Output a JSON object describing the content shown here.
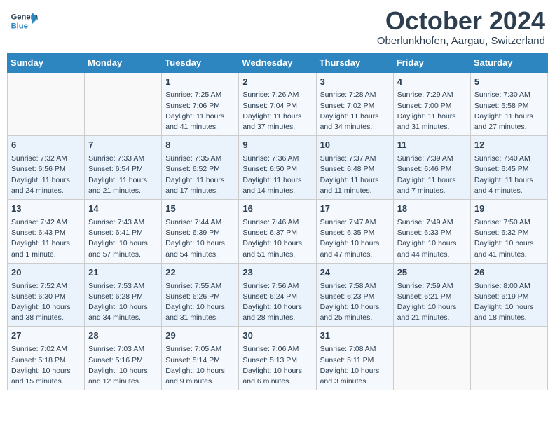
{
  "header": {
    "logo_general": "General",
    "logo_blue": "Blue",
    "month_title": "October 2024",
    "location": "Oberlunkhofen, Aargau, Switzerland"
  },
  "weekdays": [
    "Sunday",
    "Monday",
    "Tuesday",
    "Wednesday",
    "Thursday",
    "Friday",
    "Saturday"
  ],
  "weeks": [
    [
      {
        "day": "",
        "data": ""
      },
      {
        "day": "",
        "data": ""
      },
      {
        "day": "1",
        "data": "Sunrise: 7:25 AM\nSunset: 7:06 PM\nDaylight: 11 hours and 41 minutes."
      },
      {
        "day": "2",
        "data": "Sunrise: 7:26 AM\nSunset: 7:04 PM\nDaylight: 11 hours and 37 minutes."
      },
      {
        "day": "3",
        "data": "Sunrise: 7:28 AM\nSunset: 7:02 PM\nDaylight: 11 hours and 34 minutes."
      },
      {
        "day": "4",
        "data": "Sunrise: 7:29 AM\nSunset: 7:00 PM\nDaylight: 11 hours and 31 minutes."
      },
      {
        "day": "5",
        "data": "Sunrise: 7:30 AM\nSunset: 6:58 PM\nDaylight: 11 hours and 27 minutes."
      }
    ],
    [
      {
        "day": "6",
        "data": "Sunrise: 7:32 AM\nSunset: 6:56 PM\nDaylight: 11 hours and 24 minutes."
      },
      {
        "day": "7",
        "data": "Sunrise: 7:33 AM\nSunset: 6:54 PM\nDaylight: 11 hours and 21 minutes."
      },
      {
        "day": "8",
        "data": "Sunrise: 7:35 AM\nSunset: 6:52 PM\nDaylight: 11 hours and 17 minutes."
      },
      {
        "day": "9",
        "data": "Sunrise: 7:36 AM\nSunset: 6:50 PM\nDaylight: 11 hours and 14 minutes."
      },
      {
        "day": "10",
        "data": "Sunrise: 7:37 AM\nSunset: 6:48 PM\nDaylight: 11 hours and 11 minutes."
      },
      {
        "day": "11",
        "data": "Sunrise: 7:39 AM\nSunset: 6:46 PM\nDaylight: 11 hours and 7 minutes."
      },
      {
        "day": "12",
        "data": "Sunrise: 7:40 AM\nSunset: 6:45 PM\nDaylight: 11 hours and 4 minutes."
      }
    ],
    [
      {
        "day": "13",
        "data": "Sunrise: 7:42 AM\nSunset: 6:43 PM\nDaylight: 11 hours and 1 minute."
      },
      {
        "day": "14",
        "data": "Sunrise: 7:43 AM\nSunset: 6:41 PM\nDaylight: 10 hours and 57 minutes."
      },
      {
        "day": "15",
        "data": "Sunrise: 7:44 AM\nSunset: 6:39 PM\nDaylight: 10 hours and 54 minutes."
      },
      {
        "day": "16",
        "data": "Sunrise: 7:46 AM\nSunset: 6:37 PM\nDaylight: 10 hours and 51 minutes."
      },
      {
        "day": "17",
        "data": "Sunrise: 7:47 AM\nSunset: 6:35 PM\nDaylight: 10 hours and 47 minutes."
      },
      {
        "day": "18",
        "data": "Sunrise: 7:49 AM\nSunset: 6:33 PM\nDaylight: 10 hours and 44 minutes."
      },
      {
        "day": "19",
        "data": "Sunrise: 7:50 AM\nSunset: 6:32 PM\nDaylight: 10 hours and 41 minutes."
      }
    ],
    [
      {
        "day": "20",
        "data": "Sunrise: 7:52 AM\nSunset: 6:30 PM\nDaylight: 10 hours and 38 minutes."
      },
      {
        "day": "21",
        "data": "Sunrise: 7:53 AM\nSunset: 6:28 PM\nDaylight: 10 hours and 34 minutes."
      },
      {
        "day": "22",
        "data": "Sunrise: 7:55 AM\nSunset: 6:26 PM\nDaylight: 10 hours and 31 minutes."
      },
      {
        "day": "23",
        "data": "Sunrise: 7:56 AM\nSunset: 6:24 PM\nDaylight: 10 hours and 28 minutes."
      },
      {
        "day": "24",
        "data": "Sunrise: 7:58 AM\nSunset: 6:23 PM\nDaylight: 10 hours and 25 minutes."
      },
      {
        "day": "25",
        "data": "Sunrise: 7:59 AM\nSunset: 6:21 PM\nDaylight: 10 hours and 21 minutes."
      },
      {
        "day": "26",
        "data": "Sunrise: 8:00 AM\nSunset: 6:19 PM\nDaylight: 10 hours and 18 minutes."
      }
    ],
    [
      {
        "day": "27",
        "data": "Sunrise: 7:02 AM\nSunset: 5:18 PM\nDaylight: 10 hours and 15 minutes."
      },
      {
        "day": "28",
        "data": "Sunrise: 7:03 AM\nSunset: 5:16 PM\nDaylight: 10 hours and 12 minutes."
      },
      {
        "day": "29",
        "data": "Sunrise: 7:05 AM\nSunset: 5:14 PM\nDaylight: 10 hours and 9 minutes."
      },
      {
        "day": "30",
        "data": "Sunrise: 7:06 AM\nSunset: 5:13 PM\nDaylight: 10 hours and 6 minutes."
      },
      {
        "day": "31",
        "data": "Sunrise: 7:08 AM\nSunset: 5:11 PM\nDaylight: 10 hours and 3 minutes."
      },
      {
        "day": "",
        "data": ""
      },
      {
        "day": "",
        "data": ""
      }
    ]
  ]
}
